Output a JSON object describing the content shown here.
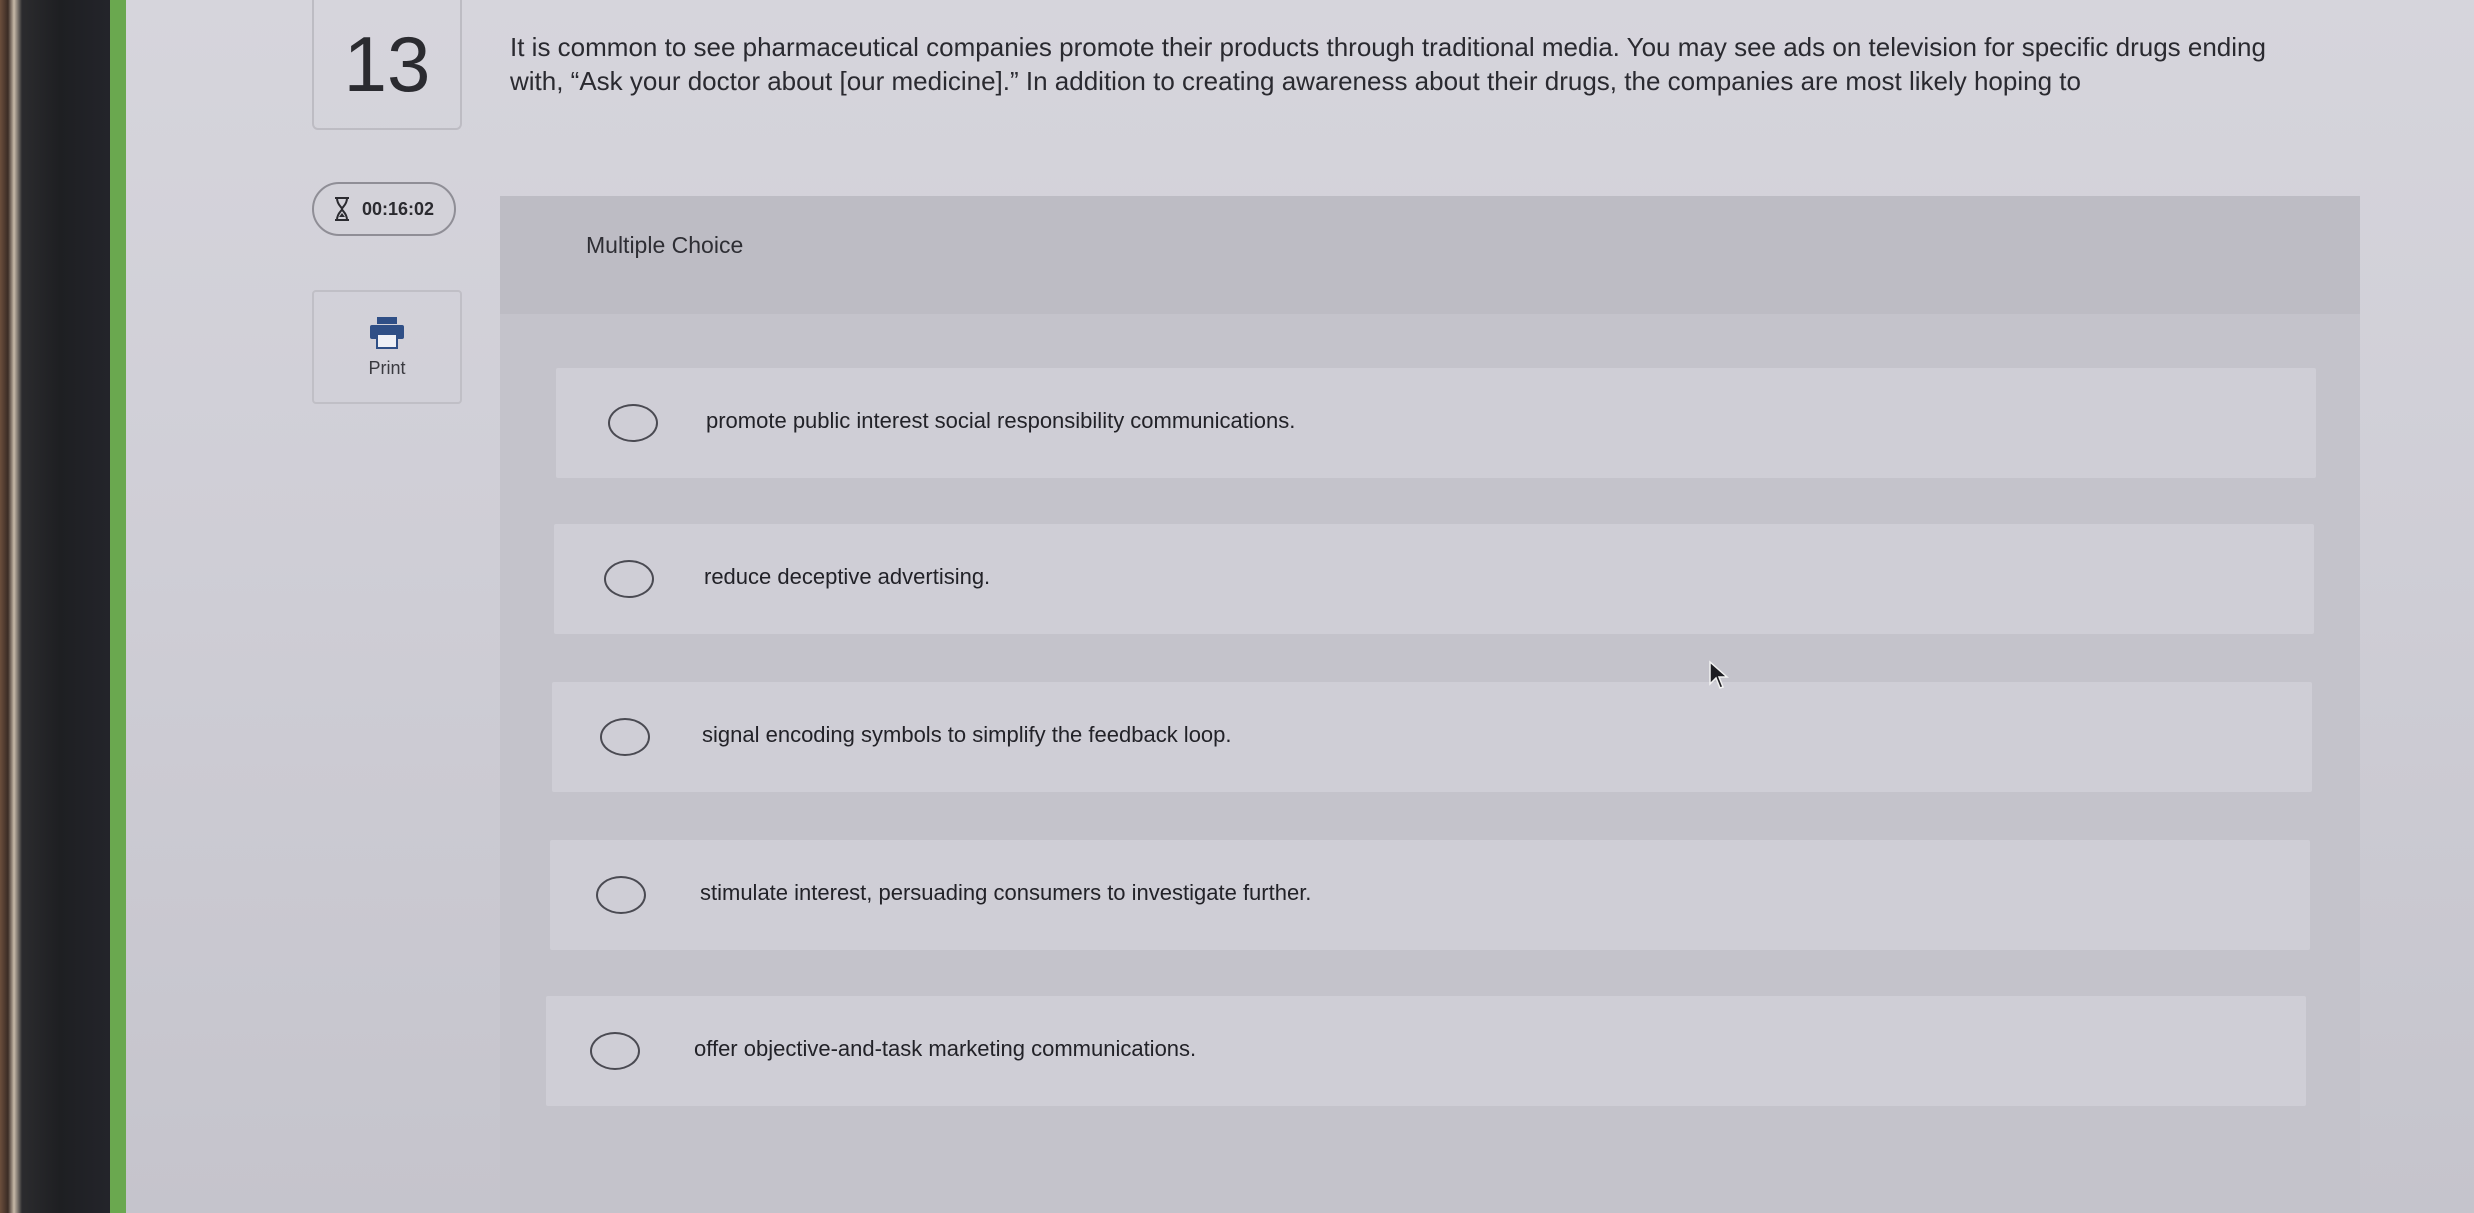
{
  "question": {
    "number": "13",
    "prompt": "It is common to see pharmaceutical companies promote their products through traditional media. You may see ads on television for specific drugs ending with, “Ask your doctor about [our medicine].” In addition to creating awareness about their drugs, the companies are most likely hoping to",
    "type_label": "Multiple Choice"
  },
  "timer": {
    "icon": "hourglass-icon",
    "value": "00:16:02"
  },
  "print": {
    "icon": "print-icon",
    "label": "Print"
  },
  "options": [
    {
      "label": "promote public interest social responsibility communications.",
      "selected": false
    },
    {
      "label": "reduce deceptive advertising.",
      "selected": false
    },
    {
      "label": "signal encoding symbols to simplify the feedback loop.",
      "selected": false
    },
    {
      "label": "stimulate interest, persuading consumers to investigate further.",
      "selected": false
    },
    {
      "label": "offer objective-and-task marketing communications.",
      "selected": false
    }
  ]
}
